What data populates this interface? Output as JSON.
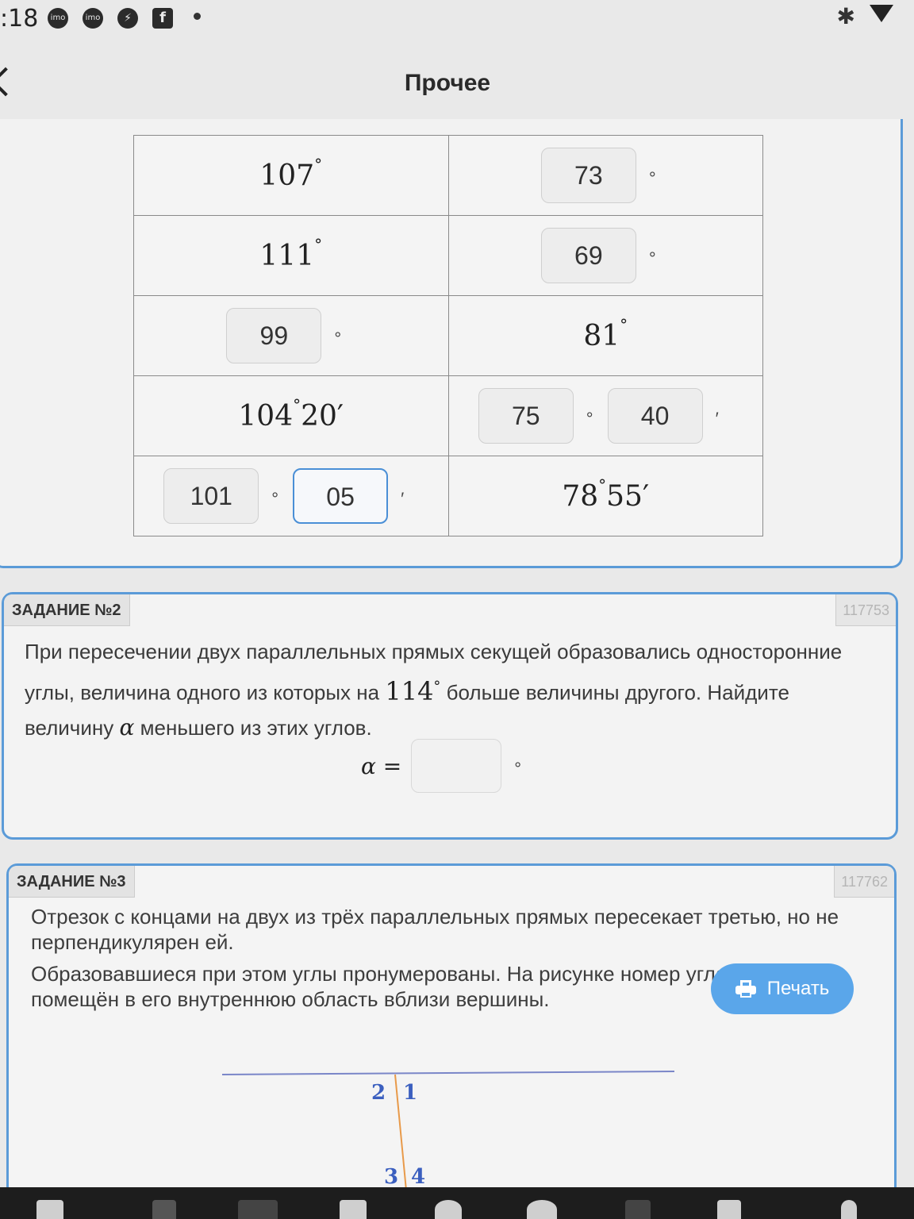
{
  "status_bar": {
    "time": ":18",
    "app_icons": [
      "imo",
      "imo",
      "messenger-icon",
      "facebook-icon"
    ]
  },
  "header": {
    "title": "Прочее"
  },
  "task1": {
    "rows": [
      {
        "left": {
          "type": "value",
          "deg": "107",
          "min": ""
        },
        "right": {
          "type": "input",
          "deg": "73",
          "min": null
        }
      },
      {
        "left": {
          "type": "value",
          "deg": "111",
          "min": ""
        },
        "right": {
          "type": "input",
          "deg": "69",
          "min": null
        }
      },
      {
        "left": {
          "type": "input",
          "deg": "99",
          "min": null
        },
        "right": {
          "type": "value",
          "deg": "81",
          "min": ""
        }
      },
      {
        "left": {
          "type": "value",
          "deg": "104",
          "min": "20"
        },
        "right": {
          "type": "input",
          "deg": "75",
          "min": "40"
        }
      },
      {
        "left": {
          "type": "input",
          "deg": "101",
          "min": "05"
        },
        "right": {
          "type": "value",
          "deg": "78",
          "min": "55"
        }
      }
    ],
    "degree_symbol": "°",
    "minute_symbol": "′"
  },
  "task2": {
    "label": "ЗАДАНИЕ №2",
    "id": "117753",
    "text_part1": "При пересечении двух параллельных прямых секущей образовались односторонние углы, величина одного из которых на",
    "value": "114",
    "text_part2": "больше величины другого. Найдите величину",
    "variable": "α",
    "text_part3": "меньшего из этих углов.",
    "answer_label": "α =",
    "answer_value": "",
    "answer_unit": "°"
  },
  "task3": {
    "label": "ЗАДАНИЕ №3",
    "id": "117762",
    "paragraph1": "Отрезок с концами на двух из трёх параллельных прямых пересекает третью, но не перпендикулярен ей.",
    "paragraph2": "Образовавшиеся при этом углы пронумерованы. На рисунке номер угла помещён в его внутреннюю область вблизи вершины.",
    "figure_labels": [
      "2",
      "1",
      "3",
      "4"
    ]
  },
  "print_button": {
    "label": "Печать"
  },
  "colors": {
    "accent": "#5b9bd8",
    "print_button": "#5aa6ea",
    "figure_line": "#7a86c8",
    "segment": "#e89a4a"
  }
}
